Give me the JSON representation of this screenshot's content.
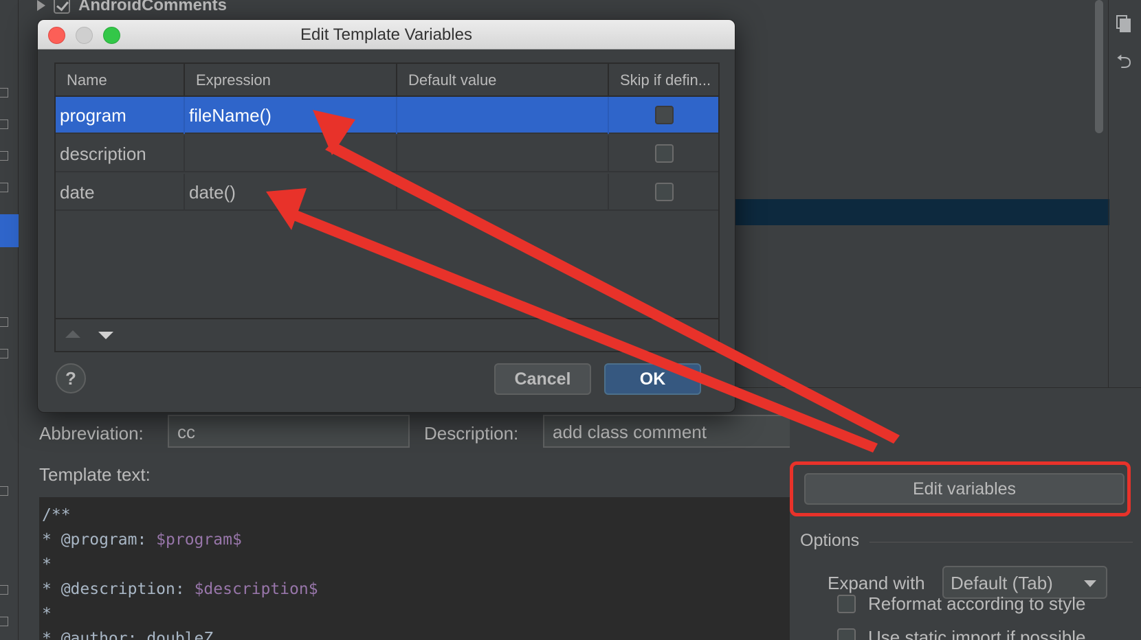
{
  "tree": {
    "item_label": "AndroidComments",
    "checked": true
  },
  "dialog": {
    "title": "Edit Template Variables",
    "columns": [
      "Name",
      "Expression",
      "Default value",
      "Skip if defin..."
    ],
    "rows": [
      {
        "name": "program",
        "expression": "fileName()",
        "default_value": "",
        "skip": false
      },
      {
        "name": "description",
        "expression": "",
        "default_value": "",
        "skip": false
      },
      {
        "name": "date",
        "expression": "date()",
        "default_value": "",
        "skip": false
      }
    ],
    "selected_row": 0,
    "help_label": "?",
    "cancel_label": "Cancel",
    "ok_label": "OK"
  },
  "form": {
    "abbreviation_label": "Abbreviation:",
    "abbreviation_value": "cc",
    "description_label": "Description:",
    "description_value": "add class comment",
    "template_text_label": "Template text:",
    "template_lines": [
      {
        "text": "/**",
        "var": ""
      },
      {
        "text": "* @program: ",
        "var": "$program$"
      },
      {
        "text": "*",
        "var": ""
      },
      {
        "text": "* @description: ",
        "var": "$description$"
      },
      {
        "text": "*",
        "var": ""
      },
      {
        "text": "* @author: doubleZ",
        "var": ""
      }
    ]
  },
  "options": {
    "edit_variables_label": "Edit variables",
    "title": "Options",
    "expand_with_label": "Expand with",
    "expand_with_value": "Default (Tab)",
    "checkboxes": [
      {
        "label": "Reformat according to style",
        "checked": false
      },
      {
        "label": "Use static import if possible",
        "checked": false
      }
    ]
  },
  "colors": {
    "annotation_red": "#e8322a",
    "selection_blue": "#2f65ca",
    "template_var_purple": "#9876aa"
  }
}
